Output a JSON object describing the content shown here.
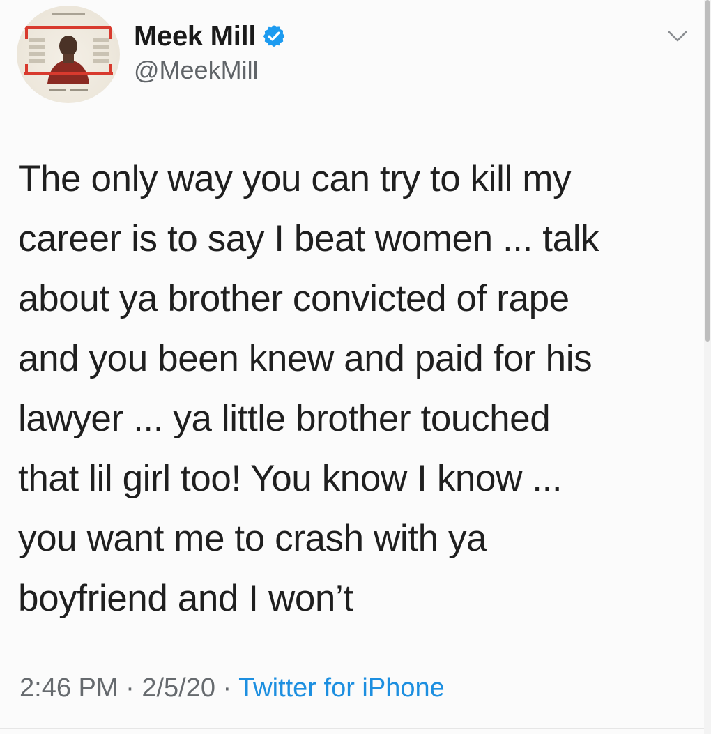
{
  "tweet": {
    "author": {
      "display_name": "Meek Mill",
      "handle": "@MeekMill",
      "verified": true,
      "avatar_icon": "free-meek-poster-avatar",
      "avatar_text": "FREE MEEK"
    },
    "lines": [
      "The only way you can try to kill my",
      "career is to say I beat women ... talk",
      "about ya brother convicted of rape",
      "and you been knew and paid for his",
      "lawyer ... ya little brother touched",
      "that lil girl too! You know I know ...",
      "you want me to crash with ya",
      "boyfriend and I won’t"
    ],
    "meta": {
      "time": "2:46 PM",
      "separator": " · ",
      "date": "2/5/20",
      "source": "Twitter for iPhone"
    }
  },
  "colors": {
    "background": "#fbfbfb",
    "text": "#1f1f1f",
    "muted": "#666a6e",
    "link": "#1d8fe0",
    "verified_badge": "#1d9bf0",
    "avatar_accent": "#d83a2e"
  },
  "icons": {
    "verified": "verified-badge-icon",
    "menu": "chevron-down-icon"
  }
}
